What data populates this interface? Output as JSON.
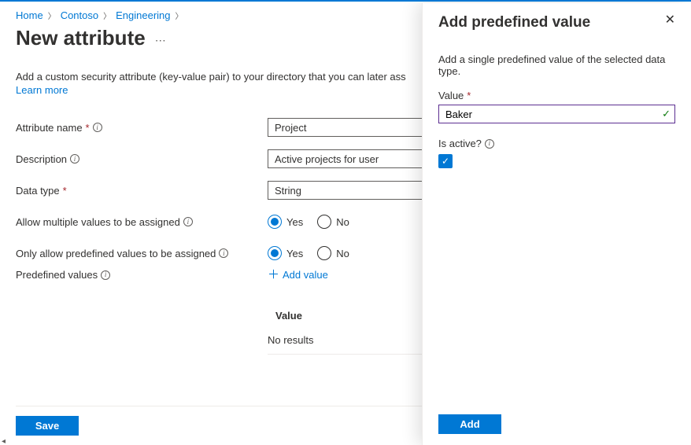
{
  "breadcrumb": [
    "Home",
    "Contoso",
    "Engineering"
  ],
  "page_title": "New attribute",
  "intro": "Add a custom security attribute (key-value pair) to your directory that you can later ass",
  "learn_more": "Learn more",
  "fields": {
    "name": {
      "label": "Attribute name",
      "value": "Project"
    },
    "description": {
      "label": "Description",
      "value": "Active projects for user"
    },
    "datatype": {
      "label": "Data type",
      "value": "String"
    },
    "multi": {
      "label": "Allow multiple values to be assigned",
      "yes": "Yes",
      "no": "No",
      "selected": "yes"
    },
    "predef": {
      "label": "Only allow predefined values to be assigned",
      "yes": "Yes",
      "no": "No",
      "selected": "yes"
    },
    "predef_values": {
      "label": "Predefined values",
      "add": "Add value",
      "col_header": "Value",
      "empty": "No results"
    }
  },
  "save": "Save",
  "panel": {
    "title": "Add predefined value",
    "desc": "Add a single predefined value of the selected data type.",
    "value_label": "Value",
    "value": "Baker",
    "active_label": "Is active?",
    "active_checked": true,
    "add": "Add"
  }
}
